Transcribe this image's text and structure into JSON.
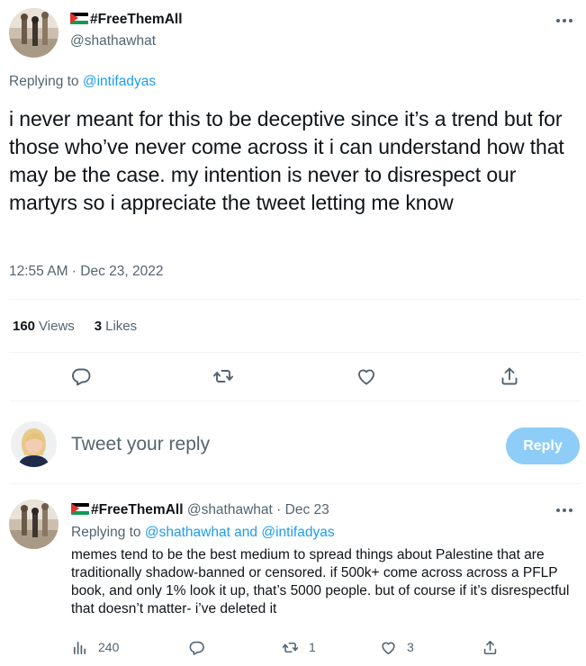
{
  "tweet": {
    "display_name": "#FreeThemAll",
    "handle": "@shathawhat",
    "replying_prefix": "Replying to",
    "replying_to": "@intifadyas",
    "text": "i never meant for this to be deceptive since it’s a trend but for those who’ve never come across it i can understand how that may be the case. my intention is never to disrespect our martyrs so i appreciate the tweet letting me know",
    "timestamp": "12:55 AM · Dec 23, 2022",
    "views_count": "160",
    "views_label": "Views",
    "likes_count": "3",
    "likes_label": "Likes",
    "actions": [
      "comment-icon",
      "retweet-icon",
      "heart-icon",
      "share-icon"
    ]
  },
  "compose": {
    "placeholder": "Tweet your reply",
    "button_label": "Reply"
  },
  "reply": {
    "display_name": "#FreeThemAll",
    "handle": "@shathawhat",
    "separator": "·",
    "date": "Dec 23",
    "replying_prefix": "Replying to",
    "replying_to": "@shathawhat and @intifadyas",
    "text": "memes tend to be the best medium to spread things about Palestine that are traditionally shadow-banned or censored. if 500k+ come across across a PFLP book, and only 1% look it up, that’s 5000 people. but of course if it’s disrespectful that doesn’t matter- i’ve deleted it",
    "views": "240",
    "retweets": "1",
    "likes": "3"
  },
  "colors": {
    "text": "#0f1419",
    "secondary": "#536471",
    "accent": "#1d9bf0",
    "reply_button_disabled": "#8ecdf7",
    "divider": "#eff3f4"
  }
}
